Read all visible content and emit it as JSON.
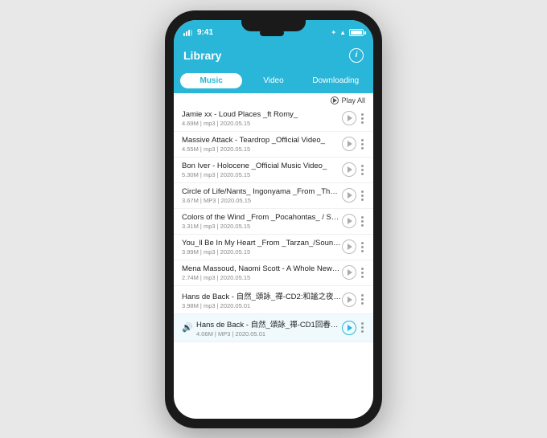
{
  "phone": {
    "status": {
      "time": "9:41",
      "battery_full": true
    },
    "header": {
      "title": "Library",
      "info_label": "i"
    },
    "tabs": [
      {
        "id": "music",
        "label": "Music",
        "active": true
      },
      {
        "id": "video",
        "label": "Video",
        "active": false
      },
      {
        "id": "downloading",
        "label": "Downloading",
        "active": false
      }
    ],
    "play_all_label": "Play All",
    "songs": [
      {
        "title": "Jamie xx - Loud Places _ft Romy_",
        "meta": "4.69M | mp3 | 2020.05.15",
        "active": false,
        "playing": false
      },
      {
        "title": "Massive Attack - Teardrop _Official Video_",
        "meta": "4.55M | mp3 | 2020.05.15",
        "active": false,
        "playing": false
      },
      {
        "title": "Bon Iver - Holocene _Official Music Video_",
        "meta": "5.30M | mp3 | 2020.05.15",
        "active": false,
        "playing": false
      },
      {
        "title": "Circle of Life/Nants_ Ingonyama _From _The Li...",
        "meta": "3.67M | MP3 | 2020.05.15",
        "active": false,
        "playing": false
      },
      {
        "title": "Colors of the Wind _From _Pocahontas_ / Sou...",
        "meta": "3.31M | mp3 | 2020.05.15",
        "active": false,
        "playing": false
      },
      {
        "title": "You_ll Be In My Heart _From _Tarzan_/Soundtr...",
        "meta": "3.99M | mp3 | 2020.05.15",
        "active": false,
        "playing": false
      },
      {
        "title": "Mena Massoud, Naomi Scott - A Whole New W...",
        "meta": "2.74M | mp3 | 2020.05.15",
        "active": false,
        "playing": false
      },
      {
        "title": "Hans de Back - 自然_頌詠_禪-CD2:和謐之夜 -...",
        "meta": "3.98M | mp3 | 2020.05.01",
        "active": false,
        "playing": false
      },
      {
        "title": "Hans de Back - 自然_頌詠_禪-CD1回春之...",
        "meta": "4.06M | MP3 | 2020.05.01",
        "active": true,
        "playing": true
      }
    ]
  }
}
